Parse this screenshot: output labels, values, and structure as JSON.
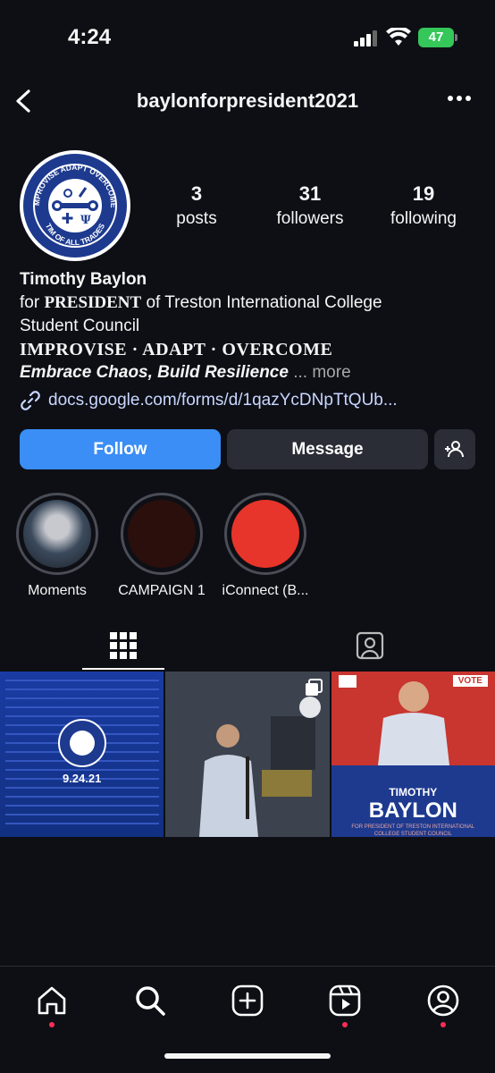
{
  "status_bar": {
    "time": "4:24",
    "battery": "47"
  },
  "header": {
    "username": "baylonforpresident2021"
  },
  "profile": {
    "avatar_text_top": "IMPROVISE ADAPT OVERCOME",
    "avatar_text_bottom": "TIM OF ALL TRADES",
    "stats": [
      {
        "value": "3",
        "label": "posts"
      },
      {
        "value": "31",
        "label": "followers"
      },
      {
        "value": "19",
        "label": "following"
      }
    ],
    "name": "Timothy Baylon",
    "bio_line1_prefix": "for ",
    "bio_line1_emph": "PRESIDENT",
    "bio_line1_suffix": " of Treston International College",
    "bio_line2": "Student Council",
    "bio_line3": "IMPROVISE · ADAPT · OVERCOME",
    "bio_line4": "Embrace Chaos, Build Resilience",
    "bio_more": "... more",
    "link": "docs.google.com/forms/d/1qazYcDNpTtQUb..."
  },
  "actions": {
    "follow": "Follow",
    "message": "Message"
  },
  "highlights": [
    {
      "label": "Moments",
      "color": "#3b4a5c"
    },
    {
      "label": "CAMPAIGN 1",
      "color": "#2a0f0c"
    },
    {
      "label": "iConnect (B...",
      "color": "#e8352b"
    }
  ],
  "posts": [
    {
      "caption": "9.24.21"
    },
    {
      "caption": ""
    },
    {
      "badge": "VOTE",
      "name_first": "TIMOTHY",
      "name_last": "BAYLON",
      "subtitle": "FOR PRESIDENT OF TRESTON INTERNATIONAL COLLEGE STUDENT COUNCIL"
    }
  ],
  "colors": {
    "accent": "#3a8ef5",
    "background": "#0d0f15",
    "notification": "#ff2d55"
  }
}
